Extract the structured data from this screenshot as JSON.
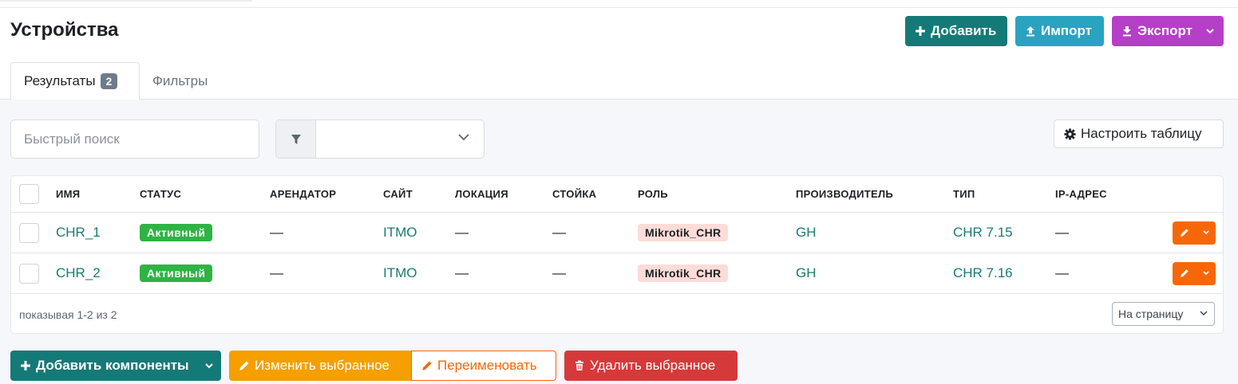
{
  "page": {
    "title": "Устройства",
    "buttons": {
      "add": "Добавить",
      "import": "Импорт",
      "export": "Экспорт"
    }
  },
  "tabs": {
    "results": {
      "label": "Результаты",
      "count": "2"
    },
    "filters": {
      "label": "Фильтры"
    }
  },
  "toolbar": {
    "quick_search_placeholder": "Быстрый поиск",
    "filter_select_value": "",
    "configure_table": "Настроить таблицу"
  },
  "table": {
    "columns": [
      "Имя",
      "Статус",
      "Арендатор",
      "Сайт",
      "Локация",
      "Стойка",
      "Роль",
      "Производитель",
      "Тип",
      "IP-адрес"
    ],
    "rows": [
      {
        "name": "CHR_1",
        "status": "Активный",
        "tenant": "—",
        "site": "ITMO",
        "location": "—",
        "rack": "—",
        "role": "Mikrotik_CHR",
        "manufacturer": "GH",
        "type": "CHR 7.15",
        "ip": "—"
      },
      {
        "name": "CHR_2",
        "status": "Активный",
        "tenant": "—",
        "site": "ITMO",
        "location": "—",
        "rack": "—",
        "role": "Mikrotik_CHR",
        "manufacturer": "GH",
        "type": "CHR 7.16",
        "ip": "—"
      }
    ],
    "footer": {
      "showing": "показывая 1-2 из 2",
      "per_page": "На страницу"
    }
  },
  "bulk": {
    "add_components": "Добавить компоненты",
    "edit_selected": "Изменить выбранное",
    "rename": "Переименовать",
    "delete_selected": "Удалить выбранное"
  },
  "colors": {
    "primary": "#147a78",
    "import": "#2aa3c1",
    "export": "#b53fc7",
    "status_active": "#2fb344",
    "role_badge": "#fcdcd8",
    "edit": "#f76707",
    "edit_selected": "#f59f00",
    "delete": "#d63939",
    "link": "#1a7a74"
  },
  "icons": [
    "plus-icon",
    "upload-icon",
    "download-icon",
    "chevron-down-icon",
    "filter-icon",
    "gear-icon",
    "pencil-icon",
    "trash-icon"
  ]
}
